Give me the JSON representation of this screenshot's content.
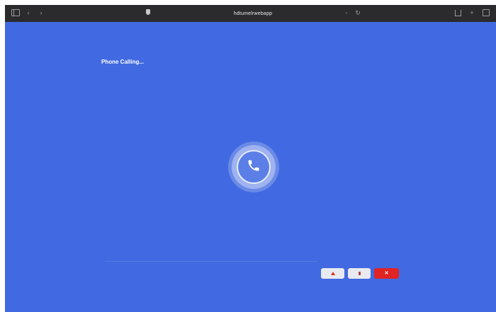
{
  "browser": {
    "address": "hdtumelrwebapp",
    "icons": {
      "sidebar": "sidebar-icon",
      "back": "back-icon",
      "forward": "forward-icon",
      "shield": "shield-icon",
      "translate": "translate-icon",
      "reload": "reload-icon",
      "share": "share-icon",
      "new_tab": "new-tab-icon",
      "tabs": "tabs-icon"
    }
  },
  "call": {
    "status": "Phone Calling...",
    "icon": "phone-icon"
  },
  "controls": [
    {
      "name": "mute-button",
      "icon": "mic-icon"
    },
    {
      "name": "camera-button",
      "icon": "camera-icon"
    },
    {
      "name": "hangup-button",
      "icon": "close-icon"
    }
  ],
  "colors": {
    "background": "#4169e1",
    "toolbar": "#2b2b2d",
    "hangup": "#e02424",
    "control_light": "#e8eaf0"
  }
}
